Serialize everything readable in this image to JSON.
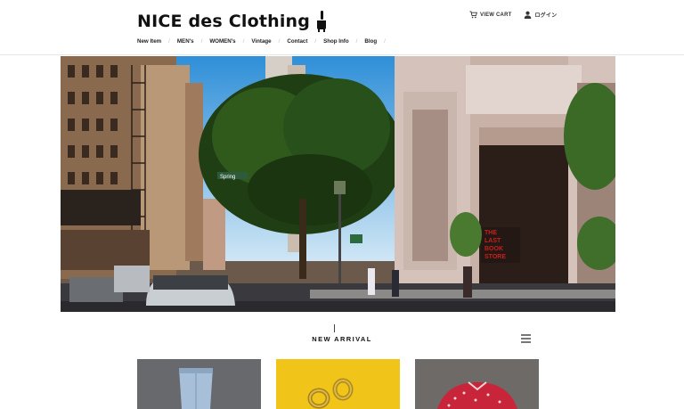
{
  "header": {
    "logo_text": "NICE des Clothing",
    "view_cart_label": "VIEW CART",
    "login_label": "ログイン"
  },
  "nav": {
    "items": [
      {
        "label": "New Item"
      },
      {
        "label": "MEN's"
      },
      {
        "label": "WOMEN's"
      },
      {
        "label": "Vintage"
      },
      {
        "label": "Contact"
      },
      {
        "label": "Shop Info"
      },
      {
        "label": "Blog"
      }
    ]
  },
  "hero": {
    "street_sign_text": "Spring",
    "store_sign_lines": [
      "THE",
      "LAST",
      "BOOK",
      "STORE"
    ]
  },
  "section": {
    "title": "NEW ARRIVAL"
  },
  "products": [
    {
      "name": "denim"
    },
    {
      "name": "gold hoop earrings"
    },
    {
      "name": "red print shirt"
    }
  ],
  "colors": {
    "text": "#222222",
    "nav_separator": "#bbbbbb",
    "store_sign_red": "#c8201c",
    "product_bg_yellow": "#f0c419"
  }
}
